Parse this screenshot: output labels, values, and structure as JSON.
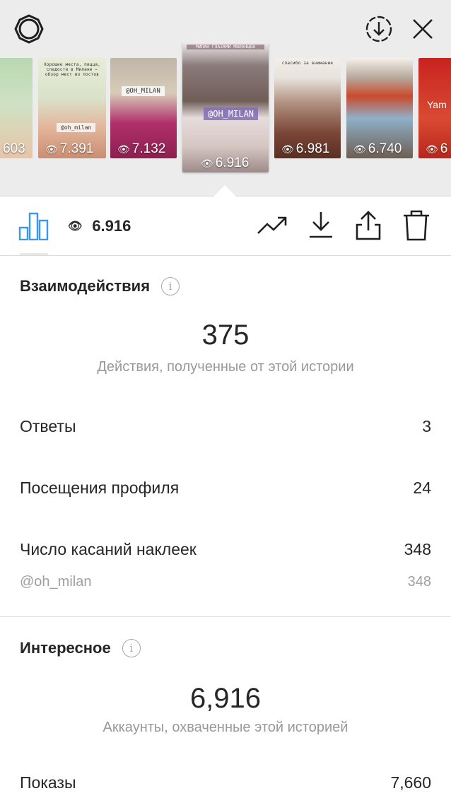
{
  "top_bar": {
    "settings_icon": "gear-icon",
    "download_icon": "download-circle-icon",
    "close_icon": "close-icon"
  },
  "thumbnails": [
    {
      "views": "603",
      "colors": [
        "#b8d8b0",
        "#e8c4a8"
      ]
    },
    {
      "views": "7.391",
      "caption": "Хорошие места, пицца, сладости в Милане — обзор мест из постов",
      "tag": "@oh_milan",
      "colors": [
        "#e9ecd8",
        "#e3b49a"
      ]
    },
    {
      "views": "7.132",
      "tag": "@OH_MILAN",
      "colors": [
        "#bfb6a8",
        "#b02f6a"
      ]
    },
    {
      "views": "6.916",
      "caption": "МИЛАН ГЛАЗАМИ МИЛАНЦЕВ",
      "tag": "@OH_MILAN",
      "colors": [
        "#8a7a7a",
        "#d6c6c2"
      ]
    },
    {
      "views": "6.981",
      "caption": "спасибо за внимание",
      "colors": [
        "#e7e2dc",
        "#7a4536"
      ]
    },
    {
      "views": "6.740",
      "colors": [
        "#b6a79a",
        "#8fb0c8"
      ]
    },
    {
      "views": "6",
      "tag": "Yam",
      "colors": [
        "#c8231f",
        "#d94a32"
      ]
    }
  ],
  "toolbar": {
    "insights_icon": "bar-chart-icon",
    "views": "6.916",
    "promote_icon": "trend-up-icon",
    "save_icon": "download-icon",
    "share_icon": "share-icon",
    "delete_icon": "trash-icon"
  },
  "interactions": {
    "title": "Взаимодействия",
    "total": "375",
    "description": "Действия, полученные от этой истории",
    "rows": [
      {
        "label": "Ответы",
        "value": "3"
      },
      {
        "label": "Посещения профиля",
        "value": "24"
      },
      {
        "label": "Число касаний наклеек",
        "value": "348"
      }
    ],
    "sticker_sub": {
      "label": "@oh_milan",
      "value": "348"
    }
  },
  "discovery": {
    "title": "Интересное",
    "total": "6,916",
    "description": "Аккаунты, охваченные этой историей",
    "rows": [
      {
        "label": "Показы",
        "value": "7,660"
      }
    ]
  },
  "colors": {
    "accent": "#3897f0",
    "text_primary": "#262626",
    "text_secondary": "#999999",
    "divider": "#dbdbdb"
  }
}
